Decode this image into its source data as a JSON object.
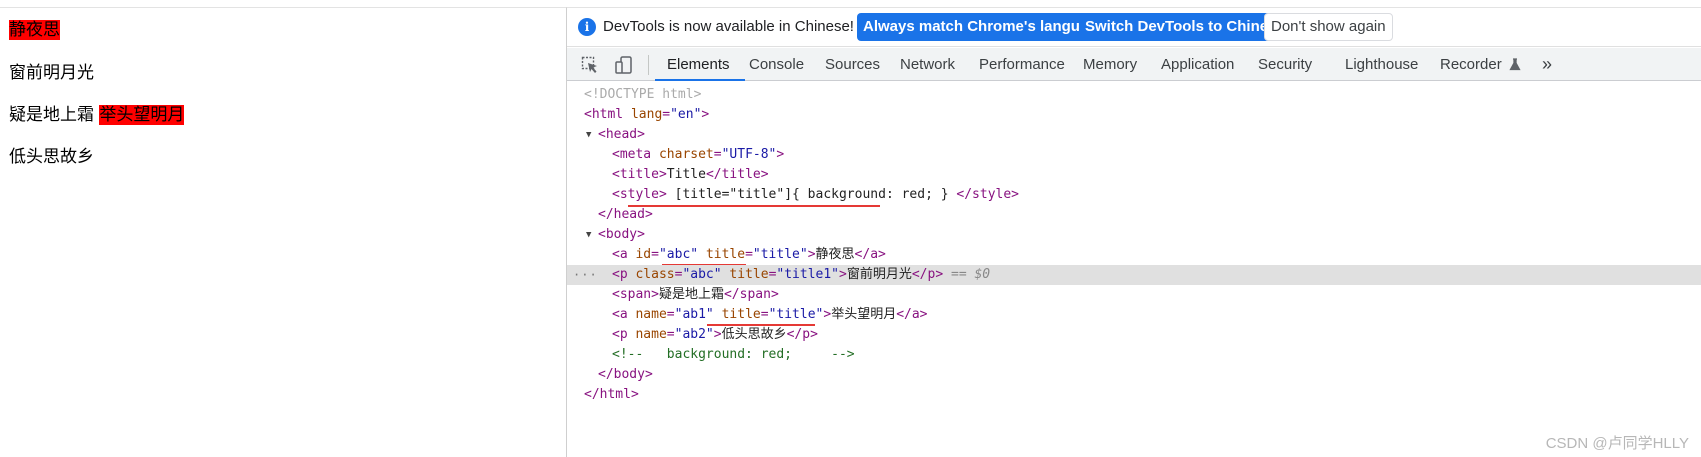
{
  "page": {
    "lines": [
      "静夜思",
      "窗前明月光",
      "疑是地上霜",
      "举头望明月",
      "低头思故乡"
    ]
  },
  "infobar": {
    "text": "DevTools is now available in Chinese!",
    "btn_match": "Always match Chrome's language",
    "btn_switch": "Switch DevTools to Chinese",
    "btn_dismiss": "Don't show again"
  },
  "tabs": [
    "Elements",
    "Console",
    "Sources",
    "Network",
    "Performance",
    "Memory",
    "Application",
    "Security",
    "Lighthouse",
    "Recorder",
    "»"
  ],
  "dom": {
    "doctype": "<!DOCTYPE html>",
    "html_open": "<html",
    "html_attr": "lang",
    "html_val": "\"en\"",
    "head_open": "<head>",
    "meta_open": "<meta",
    "meta_attr": "charset",
    "meta_val": "\"UTF-8\"",
    "meta_close": ">",
    "title_open": "<title>",
    "title_text": "Title",
    "title_close": "</title>",
    "style_open": "<style>",
    "style_text": "[title=\"title\"]{ background: red; }",
    "style_close": "</style>",
    "head_close": "</head>",
    "body_open": "<body>",
    "a1_open": "<a",
    "a1_attr1": "id",
    "a1_val1": "\"abc\"",
    "a1_attr2": "title",
    "a1_val2": "\"title\"",
    "a1_text": "静夜思",
    "a1_close": "</a>",
    "p1_open": "<p",
    "p1_attr1": "class",
    "p1_val1": "\"abc\"",
    "p1_attr2": "title",
    "p1_val2": "\"title1\"",
    "p1_text": "窗前明月光",
    "p1_close": "</p>",
    "p1_marker": "== $0",
    "span_open": "<span>",
    "span_text": "疑是地上霜",
    "span_close": "</span>",
    "a2_open": "<a",
    "a2_attr1": "name",
    "a2_val1": "\"ab1\"",
    "a2_attr2": "title",
    "a2_val2": "\"title\"",
    "a2_text": "举头望明月",
    "a2_close": "</a>",
    "p2_open": "<p",
    "p2_attr1": "name",
    "p2_val1": "\"ab2\"",
    "p2_text": "低头思故乡",
    "p2_close": "</p>",
    "comment": "<!--   background: red;     -->",
    "body_close": "</body>",
    "html_close": "</html>",
    "ellipsis": "···"
  },
  "watermark": "CSDN @卢同学HLLY",
  "colors": {
    "highlight": "#ff0000",
    "accent": "#1a73e8",
    "annotation": "#e53935"
  },
  "icons": [
    "info-icon",
    "inspect-icon",
    "device-toggle-icon",
    "flask-icon"
  ]
}
